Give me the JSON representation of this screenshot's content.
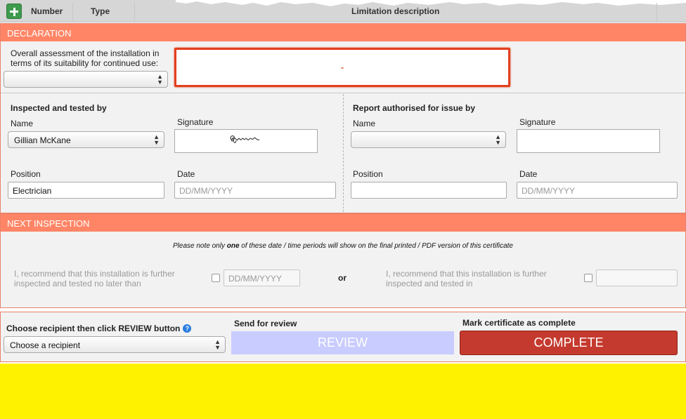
{
  "table_header": {
    "number": "Number",
    "type": "Type",
    "limitation": "Limitation description"
  },
  "declaration": {
    "title": "DECLARATION",
    "assessment_label_1": "Overall assessment of the installation in",
    "assessment_label_2": "terms of its suitability for continued use:",
    "assessment_select": "",
    "assessment_value": "-",
    "inspected": {
      "heading": "Inspected and tested by",
      "name_label": "Name",
      "name_value": "Gillian McKane",
      "signature_label": "Signature",
      "position_label": "Position",
      "position_value": "Electrician",
      "date_label": "Date",
      "date_placeholder": "DD/MM/YYYY"
    },
    "authorised": {
      "heading": "Report authorised for issue by",
      "name_label": "Name",
      "name_value": "",
      "signature_label": "Signature",
      "position_label": "Position",
      "position_value": "",
      "date_label": "Date",
      "date_placeholder": "DD/MM/YYYY"
    }
  },
  "next_inspection": {
    "title": "NEXT INSPECTION",
    "note_pre": "Please note only ",
    "note_bold": "one",
    "note_post": " of these date / time periods will show on the final printed / PDF version of this certificate",
    "left_line_1": "I, recommend that this installation is further",
    "left_line_2": "inspected and tested no later than",
    "left_placeholder": "DD/MM/YYYY",
    "or": "or",
    "right_line_1": "I, recommend that this installation is further",
    "right_line_2": "inspected and tested in"
  },
  "review_bar": {
    "recipient_label": "Choose recipient then click REVIEW button",
    "recipient_select": "Choose a recipient",
    "send_label": "Send for review",
    "review_button": "REVIEW",
    "complete_label": "Mark certificate as complete",
    "complete_button": "COMPLETE"
  },
  "colors": {
    "section_header": "#ff8566",
    "accent_red": "#e2401f",
    "complete_button": "#c53a2e",
    "review_button": "#c9ccff",
    "footer": "#fff200"
  }
}
